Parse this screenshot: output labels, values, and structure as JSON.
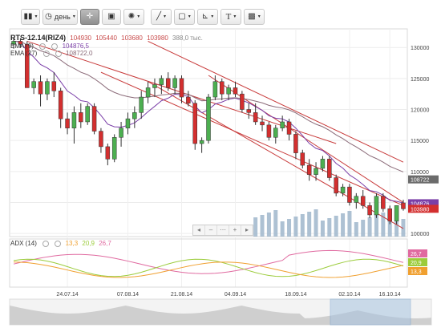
{
  "toolbar": {
    "chart_type_caret": "▾",
    "period_label": "день",
    "period_caret": "▾",
    "cursor_icon": "crosshair-icon",
    "indicators_caret": "▾",
    "draw_caret": "▾",
    "shapes_caret": "▾",
    "fib_caret": "▾",
    "text_label": "T",
    "text_caret": "▾",
    "image_caret": "▾"
  },
  "header": {
    "symbol": "RTS-12.14(RIZ4)",
    "open": "104930",
    "high": "105440",
    "low": "103680",
    "close": "103980",
    "volume": "388,0 тыс.",
    "ema9_label": "EMA (9)",
    "ema9_value": "104876,5",
    "ema27_label": "EMA (27)",
    "ema27_value": "108722,0",
    "adx_label": "ADX (14)",
    "adx_values": [
      "13,3",
      "20,9",
      "26,7"
    ]
  },
  "colors": {
    "up": "#4caf50",
    "down": "#d32f2f",
    "ema9": "#7b3fa8",
    "ema27": "#8a6a78",
    "trend": "#c83a3a",
    "volume": "#9fb6cb",
    "adx_main": "#e06aa0",
    "adx_plus": "#9ccc3c",
    "adx_minus": "#f0a030",
    "nav": "#a8c4e0"
  },
  "price_tags": [
    {
      "value": "108722",
      "color": "#6b6b6b"
    },
    {
      "value": "104876",
      "color": "#7b3fa8"
    },
    {
      "value": "103980",
      "color": "#d32f2f"
    }
  ],
  "adx_tags": [
    {
      "value": "26,7",
      "color": "#e06aa0"
    },
    {
      "value": "20,9",
      "color": "#9ccc3c"
    },
    {
      "value": "13,3",
      "color": "#f0a030"
    }
  ],
  "zoom_controls": [
    "◂",
    "–",
    "⋯",
    "+",
    "▸"
  ],
  "chart_data": {
    "type": "candlestick",
    "y_ticks": [
      "130000",
      "125000",
      "120000",
      "115000",
      "110000",
      "105000",
      "100000"
    ],
    "ylim": [
      99500,
      133000
    ],
    "x_ticks": [
      "24.07.14",
      "07.08.14",
      "21.08.14",
      "04.09.14",
      "18.09.14",
      "02.10.14",
      "16.10.14"
    ],
    "adx_ylim": [
      0,
      50
    ],
    "candles": [
      {
        "o": 130500,
        "h": 131500,
        "l": 129800,
        "c": 131000
      },
      {
        "o": 131000,
        "h": 131500,
        "l": 130000,
        "c": 130500
      },
      {
        "o": 130500,
        "h": 131000,
        "l": 126000,
        "c": 123500
      },
      {
        "o": 123500,
        "h": 125000,
        "l": 122500,
        "c": 124500
      },
      {
        "o": 124500,
        "h": 125500,
        "l": 120500,
        "c": 122500
      },
      {
        "o": 122500,
        "h": 125000,
        "l": 121500,
        "c": 124500
      },
      {
        "o": 124500,
        "h": 126000,
        "l": 122000,
        "c": 123000
      },
      {
        "o": 123000,
        "h": 123500,
        "l": 117000,
        "c": 118500
      },
      {
        "o": 118500,
        "h": 119500,
        "l": 116000,
        "c": 117000
      },
      {
        "o": 117000,
        "h": 120500,
        "l": 114500,
        "c": 119500
      },
      {
        "o": 119500,
        "h": 121000,
        "l": 117000,
        "c": 118000
      },
      {
        "o": 118000,
        "h": 121000,
        "l": 117500,
        "c": 120500
      },
      {
        "o": 120500,
        "h": 121000,
        "l": 116000,
        "c": 116500
      },
      {
        "o": 116500,
        "h": 117000,
        "l": 113000,
        "c": 114000
      },
      {
        "o": 114000,
        "h": 114500,
        "l": 111000,
        "c": 112000
      },
      {
        "o": 112000,
        "h": 116000,
        "l": 111500,
        "c": 115500
      },
      {
        "o": 115500,
        "h": 118000,
        "l": 114000,
        "c": 117000
      },
      {
        "o": 117000,
        "h": 119500,
        "l": 116000,
        "c": 118500
      },
      {
        "o": 118500,
        "h": 120500,
        "l": 117000,
        "c": 119500
      },
      {
        "o": 119500,
        "h": 123000,
        "l": 118500,
        "c": 122000
      },
      {
        "o": 122000,
        "h": 124500,
        "l": 121000,
        "c": 123500
      },
      {
        "o": 123500,
        "h": 125000,
        "l": 122000,
        "c": 124000
      },
      {
        "o": 124000,
        "h": 125500,
        "l": 122500,
        "c": 125000
      },
      {
        "o": 125000,
        "h": 126000,
        "l": 123000,
        "c": 123500
      },
      {
        "o": 123500,
        "h": 125500,
        "l": 122500,
        "c": 125000
      },
      {
        "o": 125000,
        "h": 125500,
        "l": 121000,
        "c": 122000
      },
      {
        "o": 122000,
        "h": 123000,
        "l": 120500,
        "c": 121000
      },
      {
        "o": 121000,
        "h": 121500,
        "l": 113500,
        "c": 114500
      },
      {
        "o": 114500,
        "h": 115500,
        "l": 113000,
        "c": 115000
      },
      {
        "o": 115000,
        "h": 122500,
        "l": 114500,
        "c": 122000
      },
      {
        "o": 122000,
        "h": 125500,
        "l": 121500,
        "c": 124500
      },
      {
        "o": 124500,
        "h": 125000,
        "l": 121500,
        "c": 122500
      },
      {
        "o": 122500,
        "h": 124000,
        "l": 121500,
        "c": 123500
      },
      {
        "o": 123500,
        "h": 124500,
        "l": 122000,
        "c": 122500
      },
      {
        "o": 122500,
        "h": 123000,
        "l": 119500,
        "c": 120000
      },
      {
        "o": 120000,
        "h": 121000,
        "l": 118500,
        "c": 119500
      },
      {
        "o": 119500,
        "h": 121000,
        "l": 117500,
        "c": 118000
      },
      {
        "o": 118000,
        "h": 119000,
        "l": 116500,
        "c": 117500
      },
      {
        "o": 117500,
        "h": 118000,
        "l": 115000,
        "c": 115500
      },
      {
        "o": 115500,
        "h": 117500,
        "l": 114500,
        "c": 117000
      },
      {
        "o": 117000,
        "h": 119000,
        "l": 116500,
        "c": 118000
      },
      {
        "o": 118000,
        "h": 118500,
        "l": 115000,
        "c": 116000
      },
      {
        "o": 116000,
        "h": 116500,
        "l": 112000,
        "c": 113000
      },
      {
        "o": 113000,
        "h": 113500,
        "l": 110500,
        "c": 111000
      },
      {
        "o": 111000,
        "h": 112000,
        "l": 108500,
        "c": 109500
      },
      {
        "o": 109500,
        "h": 111500,
        "l": 108500,
        "c": 110500
      },
      {
        "o": 110500,
        "h": 112500,
        "l": 110000,
        "c": 112000
      },
      {
        "o": 112000,
        "h": 112500,
        "l": 108500,
        "c": 109000
      },
      {
        "o": 109000,
        "h": 109500,
        "l": 106000,
        "c": 106500
      },
      {
        "o": 106500,
        "h": 108000,
        "l": 106000,
        "c": 107500
      },
      {
        "o": 107500,
        "h": 108000,
        "l": 104500,
        "c": 105000
      },
      {
        "o": 105000,
        "h": 106500,
        "l": 104000,
        "c": 106000
      },
      {
        "o": 106000,
        "h": 107000,
        "l": 104000,
        "c": 104500
      },
      {
        "o": 104500,
        "h": 105000,
        "l": 102500,
        "c": 103000
      },
      {
        "o": 103000,
        "h": 106500,
        "l": 102500,
        "c": 106000
      },
      {
        "o": 106000,
        "h": 106500,
        "l": 103500,
        "c": 104000
      },
      {
        "o": 104000,
        "h": 104500,
        "l": 101500,
        "c": 102000
      },
      {
        "o": 102000,
        "h": 104500,
        "l": 101500,
        "c": 104500
      },
      {
        "o": 104930,
        "h": 105440,
        "l": 103680,
        "c": 103980
      }
    ],
    "volumes": [
      0,
      0,
      0,
      0,
      0,
      0,
      0,
      0,
      0,
      0,
      0,
      0,
      0,
      0,
      0,
      0,
      0,
      0,
      0,
      0,
      0,
      0,
      0,
      0,
      0,
      0,
      0,
      0,
      0,
      0,
      0,
      0,
      0,
      0,
      0,
      0,
      0,
      0,
      0,
      0,
      0,
      0,
      0,
      0,
      0,
      0,
      0,
      0,
      0,
      0,
      0,
      0,
      0,
      0,
      0,
      0,
      0,
      0,
      0
    ]
  }
}
